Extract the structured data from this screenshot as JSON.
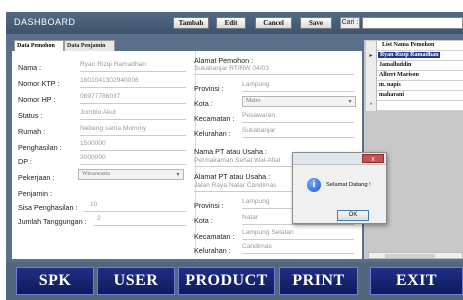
{
  "header": {
    "title": "DASHBOARD",
    "buttons": [
      "Tambah",
      "Edit",
      "Cancel",
      "Save"
    ],
    "search_label": "Cari :",
    "search_value": ""
  },
  "tabs": [
    "Data Pemohon",
    "Data Penjamin"
  ],
  "form_left": {
    "nama_label": "Nama :",
    "nama_value": "Ryan Rizqi Ramadhan",
    "ktp_label": "Nomor KTP :",
    "ktp_value": "1801041302940006",
    "hp_label": "Nomor HP :",
    "hp_value": "08977786037",
    "status_label": "Status :",
    "status_value": "Jomblo Akut",
    "rumah_label": "Rumah :",
    "rumah_value": "Nebeng sama Mommy",
    "penghasilan_label": "Penghasilan :",
    "penghasilan_value": "1500000",
    "dp_label": "DP :",
    "dp_value": "3000000",
    "pekerjaan_label": "Pekerjaan :",
    "pekerjaan_value": "Wiraswasta",
    "penjamin_label": "Penjamin :",
    "sisa_label": "Sisa Penghasilan :",
    "sisa_value": "10",
    "tanggungan_label": "Jumlah Tanggungan :",
    "tanggungan_value": "2"
  },
  "form_right": {
    "alamat_label": "Alamat Pemohon :",
    "alamat_value": "Sukabanjar RT/RW 04/03",
    "provinsi_label": "Provinsi :",
    "provinsi_value": "Lampung",
    "kota_label": "Kota :",
    "kota_value": "Metro",
    "kecamatan_label": "Kecamatan :",
    "kecamatan_value": "Pesawaran",
    "kelurahan_label": "Kelurahan :",
    "kelurahan_value": "Sukabanjar",
    "pt_label": "Nama PT atau Usaha :",
    "pt_value": "Permakaman Sehat Wal-Afiat",
    "alamat_pt_label": "Alamat PT atau Usaha :",
    "alamat_pt_value": "Jalan Raya Natar Candimas",
    "provinsi2_label": "Provinsi :",
    "provinsi2_value": "Lampung",
    "kota2_label": "Kota :",
    "kota2_value": "Natar",
    "kecamatan2_label": "Kecamatan :",
    "kecamatan2_value": "Lampung Selatan",
    "kelurahan2_label": "Kelurahan :",
    "kelurahan2_value": "Candimas"
  },
  "list": {
    "header": "List Nama Pemohon",
    "rows": [
      "Ryan Rizqi Ramadhan",
      "Jamalluddin",
      "Albert Marison",
      "m. napis",
      "maharani"
    ]
  },
  "dialog": {
    "message": "Selamat Datang !",
    "ok_label": "OK",
    "close_label": "x"
  },
  "bottom_buttons": [
    "SPK",
    "USER",
    "PRODUCT",
    "PRINT",
    "EXIT"
  ]
}
